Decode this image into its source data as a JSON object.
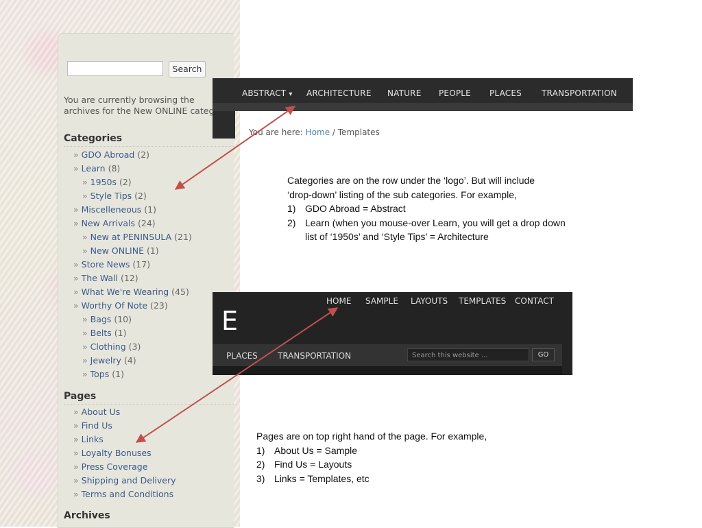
{
  "sidebar": {
    "search_button": "Search",
    "browse_text_line1": "You are currently browsing the",
    "browse_text_line2": "archives for the New ONLINE categ",
    "categories_title": "Categories",
    "categories": [
      {
        "name": "GDO Abroad",
        "count": "(2)"
      },
      {
        "name": "Learn",
        "count": "(8)"
      },
      {
        "name": "1950s",
        "count": "(2)"
      },
      {
        "name": "Style Tips",
        "count": "(2)"
      },
      {
        "name": "Miscelleneous",
        "count": "(1)"
      },
      {
        "name": "New Arrivals",
        "count": "(24)"
      },
      {
        "name": "New at PENINSULA",
        "count": "(21)"
      },
      {
        "name": "New ONLINE",
        "count": "(1)"
      },
      {
        "name": "Store News",
        "count": "(17)"
      },
      {
        "name": "The Wall",
        "count": "(12)"
      },
      {
        "name": "What We're Wearing",
        "count": "(45)"
      },
      {
        "name": "Worthy Of Note",
        "count": "(23)"
      },
      {
        "name": "Bags",
        "count": "(10)"
      },
      {
        "name": "Belts",
        "count": "(1)"
      },
      {
        "name": "Clothing",
        "count": "(3)"
      },
      {
        "name": "Jewelry",
        "count": "(4)"
      },
      {
        "name": "Tops",
        "count": "(1)"
      }
    ],
    "pages_title": "Pages",
    "pages": [
      "About Us",
      "Find Us",
      "Links",
      "Loyalty Bonuses",
      "Press Coverage",
      "Shipping and Delivery",
      "Terms and Conditions"
    ],
    "archives_title": "Archives",
    "arrow_glyph": "»"
  },
  "nav1": {
    "items": [
      "ABSTRACT",
      "ARCHITECTURE",
      "NATURE",
      "PEOPLE",
      "PLACES",
      "TRANSPORTATION"
    ],
    "dropdown_glyph": "▾"
  },
  "breadcrumb": {
    "prefix": "You are here:",
    "home": "Home",
    "current": "/ Templates"
  },
  "note1": {
    "line1": "Categories are on the row under the ‘logo’. But will include",
    "line2": "‘drop-down’ listing of the sub categories. For example,",
    "items": [
      {
        "num": "1)",
        "text": "GDO Abroad = Abstract"
      },
      {
        "num": "2)",
        "text": "Learn (when you mouse-over Learn, you will get a drop down"
      }
    ],
    "item2_line2": "list of ‘1950s’ and ‘Style Tips’ = Architecture"
  },
  "shot2": {
    "top_items": [
      "HOME",
      "SAMPLE",
      "LAYOUTS",
      "TEMPLATES",
      "CONTACT"
    ],
    "logo": "E",
    "bar_items": [
      "PLACES",
      "TRANSPORTATION"
    ],
    "search_placeholder": "Search this website ...",
    "go_label": "GO"
  },
  "note2": {
    "line1": "Pages are on top right hand of the page. For example,",
    "items": [
      {
        "num": "1)",
        "text": "About Us = Sample"
      },
      {
        "num": "2)",
        "text": "Find Us = Layouts"
      },
      {
        "num": "3)",
        "text": "Links = Templates, etc"
      }
    ]
  },
  "colors": {
    "annotation_arrow": "#c0504d",
    "link": "#3b5a8a",
    "nav_dark": "#2b2b2b"
  }
}
